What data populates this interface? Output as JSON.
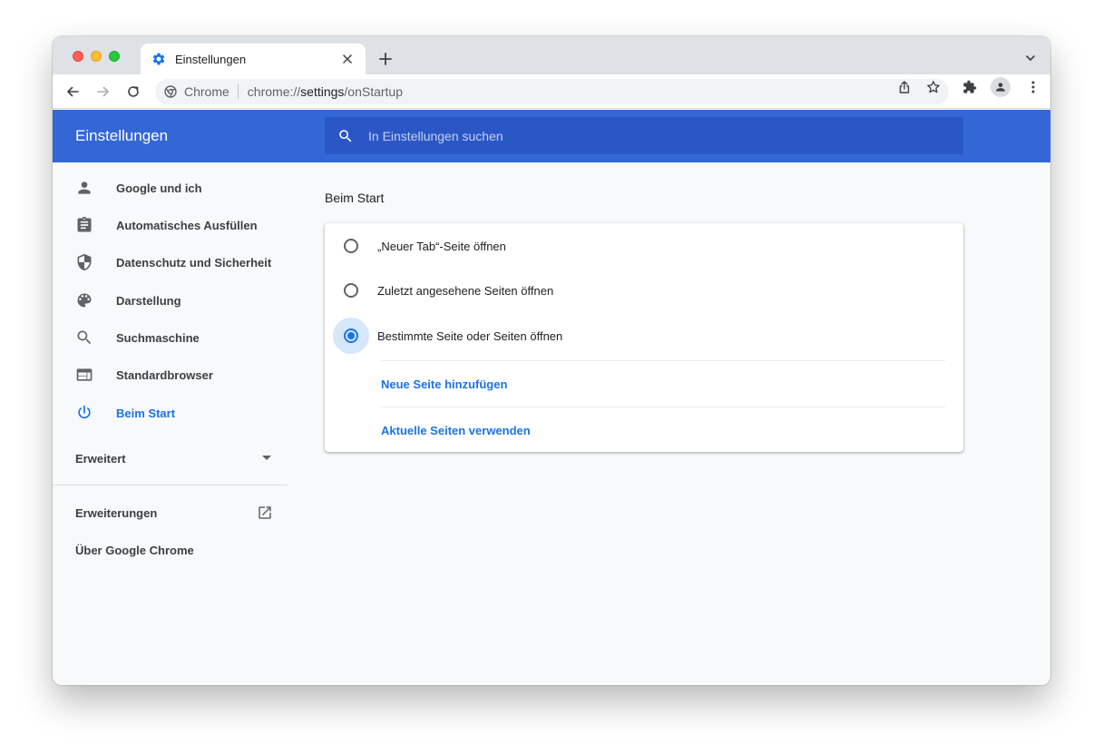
{
  "browser": {
    "tab_title": "Einstellungen",
    "omnibox": {
      "site_name": "Chrome",
      "url_scheme": "chrome://",
      "url_host": "settings",
      "url_path": "/onStartup"
    }
  },
  "header": {
    "title": "Einstellungen",
    "search_placeholder": "In Einstellungen suchen"
  },
  "sidebar": {
    "items": [
      {
        "label": "Google und ich",
        "icon": "person-icon"
      },
      {
        "label": "Automatisches Ausfüllen",
        "icon": "clipboard-icon"
      },
      {
        "label": "Datenschutz und Sicherheit",
        "icon": "shield-icon"
      },
      {
        "label": "Darstellung",
        "icon": "palette-icon"
      },
      {
        "label": "Suchmaschine",
        "icon": "search-icon"
      },
      {
        "label": "Standardbrowser",
        "icon": "browser-window-icon"
      },
      {
        "label": "Beim Start",
        "icon": "power-icon",
        "active": true
      }
    ],
    "advanced_label": "Erweitert",
    "extensions_label": "Erweiterungen",
    "about_label": "Über Google Chrome"
  },
  "main": {
    "section_title": "Beim Start",
    "options": [
      {
        "label": "„Neuer Tab“-Seite öffnen",
        "selected": false
      },
      {
        "label": "Zuletzt angesehene Seiten öffnen",
        "selected": false
      },
      {
        "label": "Bestimmte Seite oder Seiten öffnen",
        "selected": true
      }
    ],
    "add_page_label": "Neue Seite hinzufügen",
    "use_current_label": "Aktuelle Seiten verwenden"
  },
  "colors": {
    "accent": "#1a73e8",
    "header_bg": "#3367d6",
    "search_bg": "#2a56c6",
    "page_bg": "#f8f9fa"
  }
}
